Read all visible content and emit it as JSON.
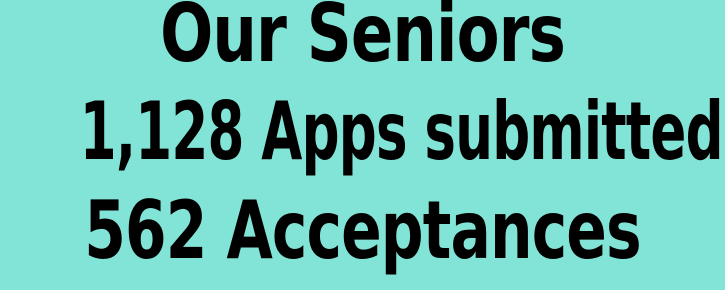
{
  "headline": {
    "line1": "Our Seniors",
    "line2": "1,128 Apps submitted",
    "line3": "562 Acceptances"
  },
  "colors": {
    "background": "#82e3d7",
    "text": "#000000"
  }
}
